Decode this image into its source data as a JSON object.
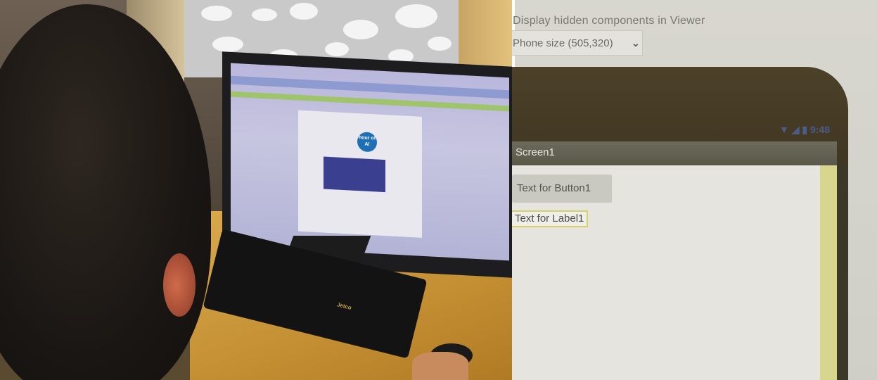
{
  "left_photo": {
    "keyboard_brand": "Jetco",
    "screen_badge": "hour of AI"
  },
  "viewer": {
    "hidden_components_text": "Display hidden components in Viewer",
    "size_dropdown": {
      "selected": "Phone size (505,320)",
      "chevron_icon": "chevron-down-icon"
    },
    "status_bar": {
      "icons": [
        "wifi-icon",
        "signal-icon",
        "battery-icon"
      ],
      "time": "9:48"
    },
    "screen_title": "Screen1",
    "button1_text": "Text for Button1",
    "label1_text": "Text for Label1"
  }
}
